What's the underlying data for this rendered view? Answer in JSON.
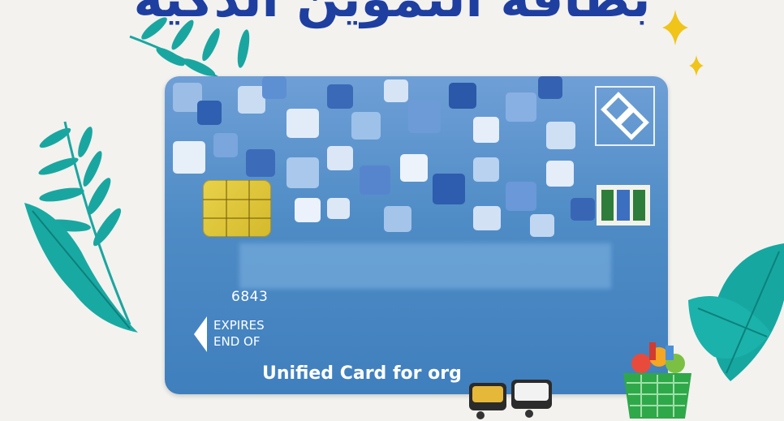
{
  "banner": {
    "text": "ﺑﻄﺎﻗﺔ ﺍﻟﺘﻤﻮﻳﻦ ﺍﻟﺬﻛﻴﺔ"
  },
  "card": {
    "number_suffix": "6843",
    "expires_line1": "EXPIRES",
    "expires_line2": "END OF",
    "title": "Unified Card for org",
    "colors": {
      "base": "#4f8cc6",
      "chip": "#e2cb3c",
      "bar_green": "#2f7d3a",
      "bar_blue": "#3c6fc0"
    }
  },
  "decor": {
    "leaf_color": "#1aa6a0",
    "sparkle_color": "#f0c419",
    "basket_color": "#2fa84a"
  }
}
